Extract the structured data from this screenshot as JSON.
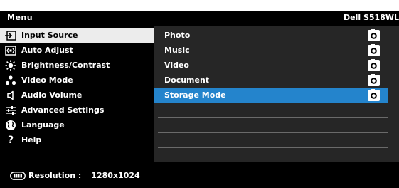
{
  "menu": {
    "title": "Menu",
    "model": "Dell S518WL",
    "items": [
      {
        "label": "Input Source",
        "icon": "input-source-icon",
        "selected": true
      },
      {
        "label": "Auto Adjust",
        "icon": "auto-adjust-icon"
      },
      {
        "label": "Brightness/Contrast",
        "icon": "brightness-icon"
      },
      {
        "label": "Video Mode",
        "icon": "video-mode-icon"
      },
      {
        "label": "Audio Volume",
        "icon": "speaker-icon"
      },
      {
        "label": "Advanced Settings",
        "icon": "sliders-icon"
      },
      {
        "label": "Language",
        "icon": "globe-icon"
      },
      {
        "label": "Help",
        "icon": "question-icon"
      }
    ]
  },
  "submenu": {
    "items": [
      {
        "label": "Photo",
        "icon": "usb-camera-icon"
      },
      {
        "label": "Music",
        "icon": "usb-camera-icon"
      },
      {
        "label": "Video",
        "icon": "usb-camera-icon"
      },
      {
        "label": "Document",
        "icon": "usb-camera-icon"
      },
      {
        "label": "Storage Mode",
        "icon": "usb-camera-icon",
        "highlighted": true
      }
    ]
  },
  "status": {
    "resolution_label": "Resolution :",
    "resolution_value": "1280x1024",
    "icon": "display-icon"
  },
  "colors": {
    "highlight": "#2484cc",
    "selected_bg": "#ececec",
    "panel_bg": "#262626"
  }
}
